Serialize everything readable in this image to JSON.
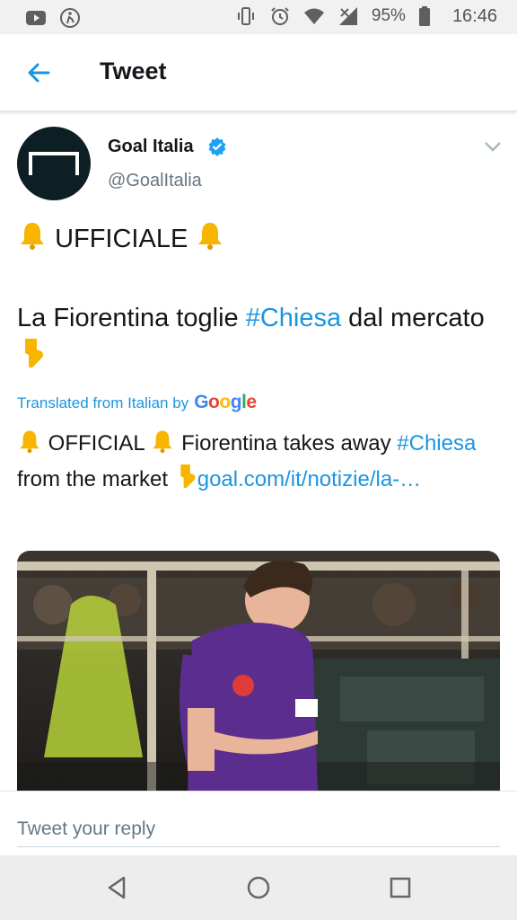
{
  "status_bar": {
    "battery": "95%",
    "time": "16:46",
    "icons": [
      "youtube-icon",
      "accessibility-icon",
      "vibrate-icon",
      "alarm-icon",
      "wifi-icon",
      "signal-icon",
      "battery-icon"
    ]
  },
  "header": {
    "title": "Tweet",
    "back_icon": "back-arrow-icon"
  },
  "tweet": {
    "author": {
      "name": "Goal Italia",
      "handle": "@GoalItalia",
      "verified": true
    },
    "text": {
      "line1": "UFFICIALE",
      "line2_pre": "La Fiorentina toglie ",
      "line2_hashtag": "#Chiesa",
      "line2_post": " dal mercato"
    },
    "translated_label": "Translated from Italian by",
    "translated_provider": "Google",
    "translation": {
      "part1": " OFFICIAL ",
      "part2": " Fiorentina takes away ",
      "hashtag": "#Chiesa",
      "part3": " from the market ",
      "link": "goal.com/it/notizie/la-…"
    }
  },
  "reply": {
    "placeholder": "Tweet your reply"
  },
  "nav": {
    "icons": [
      "back-nav-icon",
      "home-nav-icon",
      "recents-nav-icon"
    ]
  },
  "colors": {
    "accent": "#1b95e0",
    "status_bar_bg": "#f1f1f1",
    "nav_bar_bg": "#ededed",
    "fiorentina_purple": "#5b2d8e"
  }
}
